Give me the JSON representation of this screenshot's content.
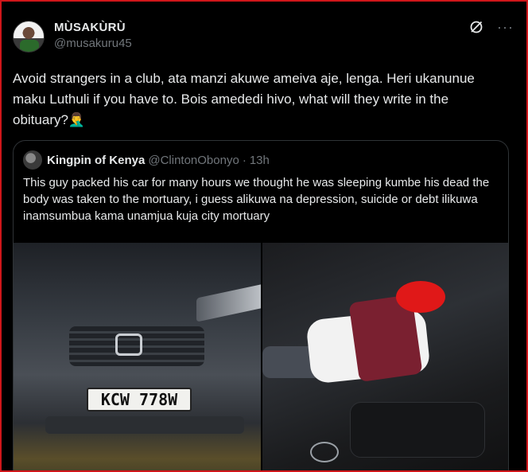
{
  "tweet": {
    "display_name": "MÙSAKÙRÙ",
    "handle": "@musakuru45",
    "text": "Avoid strangers in a club, ata manzi akuwe ameiva aje, lenga.  Heri ukanunue maku Luthuli if you have to. Bois amededi hivo, what will they write in the obituary?🤦‍♂️",
    "more_label": "···"
  },
  "quote": {
    "display_name": "Kingpin of Kenya",
    "handle": "@ClintonObonyo",
    "separator": "·",
    "time": "13h",
    "text": "This guy packed his car for many hours we thought he was sleeping kumbe his dead the body was taken to the mortuary, i guess alikuwa na depression, suicide or debt ilikuwa inamsumbua kama unamjua kuja city mortuary"
  },
  "media": {
    "plate": "KCW 778W"
  },
  "colors": {
    "background": "#000000",
    "text_primary": "#e7e9ea",
    "text_secondary": "#71767b",
    "border": "#2f3336",
    "frame": "#d0161a"
  }
}
